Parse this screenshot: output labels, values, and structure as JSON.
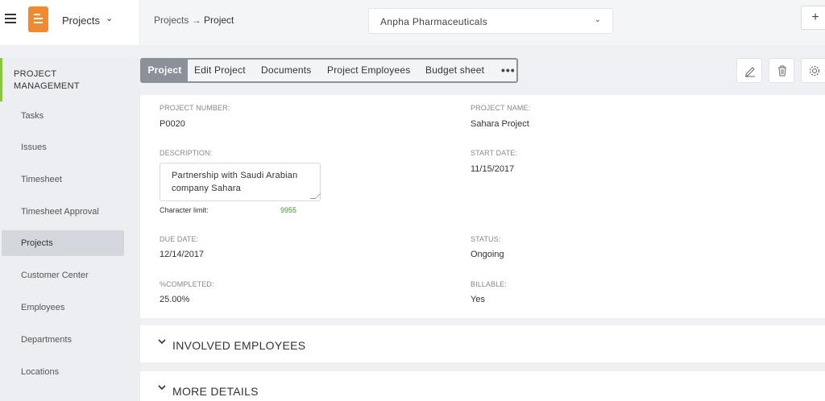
{
  "topbar": {
    "app_name": "Projects",
    "breadcrumb_parent": "Projects",
    "breadcrumb_arrow": "→",
    "breadcrumb_current": "Project",
    "company": "Anpha Pharmaceuticals",
    "add_label": "+"
  },
  "sidebar": {
    "header": "PROJECT MANAGEMENT",
    "items": [
      {
        "label": "Tasks"
      },
      {
        "label": "Issues"
      },
      {
        "label": "Timesheet"
      },
      {
        "label": "Timesheet Approval"
      },
      {
        "label": "Projects",
        "active": true
      },
      {
        "label": "Customer Center"
      },
      {
        "label": "Employees"
      },
      {
        "label": "Departments"
      },
      {
        "label": "Locations"
      }
    ]
  },
  "tabs": [
    {
      "label": "Project",
      "active": true
    },
    {
      "label": "Edit Project"
    },
    {
      "label": "Documents"
    },
    {
      "label": "Project Employees"
    },
    {
      "label": "Budget sheet"
    }
  ],
  "tabs_more": "•••",
  "actions": {
    "edit_icon": "pencil-icon",
    "delete_icon": "trash-icon",
    "settings_icon": "gear-icon"
  },
  "project": {
    "number_label": "PROJECT NUMBER:",
    "number": "P0020",
    "name_label": "PROJECT NAME:",
    "name": "Sahara Project",
    "description_label": "DESCRIPTION:",
    "description": "Partnership with Saudi Arabian company Sahara",
    "char_limit_label": "Character limit:",
    "char_limit_value": "9955",
    "start_date_label": "START DATE:",
    "start_date": "11/15/2017",
    "due_date_label": "DUE DATE:",
    "due_date": "12/14/2017",
    "status_label": "STATUS:",
    "status": "Ongoing",
    "completed_label": "%COMPLETED:",
    "completed": "25.00%",
    "billable_label": "BILLABLE:",
    "billable": "Yes"
  },
  "sections": {
    "involved": "INVOLVED EMPLOYEES",
    "more": "MORE DETAILS"
  },
  "colors": {
    "accent_orange": "#f08a2c",
    "sidebar_accent_green": "#8cc63f",
    "tab_active": "#8c9099",
    "char_limit_green": "#3a9a2a"
  }
}
